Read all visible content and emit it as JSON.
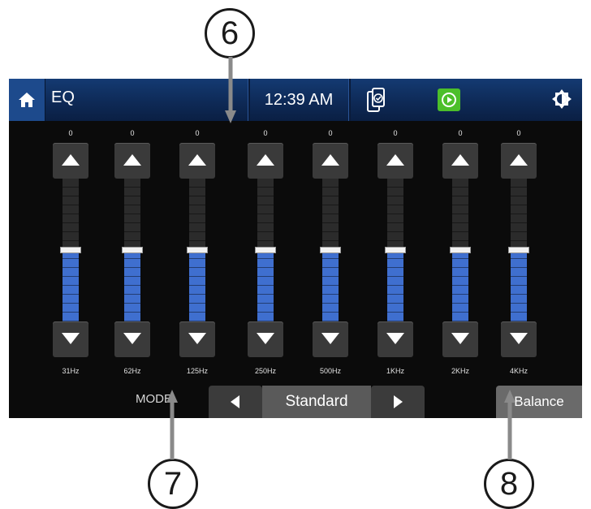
{
  "topbar": {
    "title": "EQ",
    "clock": "12:39 AM"
  },
  "eq": {
    "bands": [
      {
        "label": "31Hz",
        "value": "0"
      },
      {
        "label": "62Hz",
        "value": "0"
      },
      {
        "label": "125Hz",
        "value": "0"
      },
      {
        "label": "250Hz",
        "value": "0"
      },
      {
        "label": "500Hz",
        "value": "0"
      },
      {
        "label": "1KHz",
        "value": "0"
      },
      {
        "label": "2KHz",
        "value": "0"
      },
      {
        "label": "4KHz",
        "value": "0"
      }
    ]
  },
  "bottombar": {
    "mode_label": "MODE",
    "mode_value": "Standard",
    "balance_label": "Balance"
  },
  "callouts": {
    "c6": "6",
    "c7": "7",
    "c8": "8"
  },
  "colors": {
    "header_blue": "#143a72",
    "slider_blue": "#3f6fcf",
    "play_green": "#4cbf2a"
  },
  "icons": [
    "home-icon",
    "phone-link-icon",
    "play-icon",
    "brightness-icon",
    "arrow-up-icon",
    "arrow-down-icon",
    "arrow-left-icon",
    "arrow-right-icon"
  ]
}
